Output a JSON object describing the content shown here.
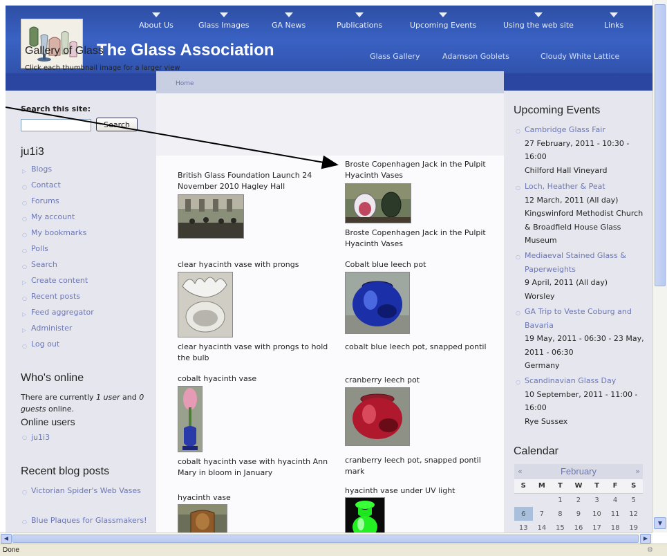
{
  "header": {
    "site_name": "The Glass Association",
    "nav": [
      "About Us",
      "Glass Images",
      "GA News",
      "Publications",
      "Upcoming Events",
      "Using the web site",
      "Links"
    ],
    "subnav": [
      "Glass Gallery",
      "Adamson Goblets",
      "Cloudy White Lattice"
    ]
  },
  "breadcrumb": "Home",
  "page": {
    "title": "Gallery of Glass",
    "intro": "Click each thumbnail image for a larger view"
  },
  "gallery": [
    {
      "title": "British Glass Foundation Launch 24 November 2010 Hagley Hall",
      "caption": ""
    },
    {
      "title": "Broste Copenhagen Jack in the Pulpit Hyacinth Vases",
      "caption": "Broste Copenhagen Jack in the Pulpit Hyacinth Vases"
    },
    {
      "title": "clear hyacinth vase with prongs",
      "caption": "clear hyacinth vase with prongs to hold the bulb"
    },
    {
      "title": "Cobalt blue leech pot",
      "caption": "cobalt blue leech pot, snapped pontil"
    },
    {
      "title": "cobalt hyacinth vase",
      "caption": "cobalt hyacinth vase with hyacinth Ann Mary in bloom in January"
    },
    {
      "title": "cranberry leech pot",
      "caption": "cranberry leech pot, snapped pontil mark"
    },
    {
      "title": "hyacinth vase",
      "caption": ""
    },
    {
      "title": "hyacinth vase under UV light",
      "caption": ""
    }
  ],
  "left_sidebar": {
    "search_label": "Search this site:",
    "search_value": "",
    "search_button": "Search",
    "user_title": "ju1i3",
    "menu": [
      {
        "label": "Blogs",
        "icon": "collapsed-arrow-icon"
      },
      {
        "label": "Contact",
        "icon": "leaf-bullet-icon"
      },
      {
        "label": "Forums",
        "icon": "leaf-bullet-icon"
      },
      {
        "label": "My account",
        "icon": "leaf-bullet-icon"
      },
      {
        "label": "My bookmarks",
        "icon": "leaf-bullet-icon"
      },
      {
        "label": "Polls",
        "icon": "leaf-bullet-icon"
      },
      {
        "label": "Search",
        "icon": "leaf-bullet-icon"
      },
      {
        "label": "Create content",
        "icon": "collapsed-arrow-icon"
      },
      {
        "label": "Recent posts",
        "icon": "leaf-bullet-icon"
      },
      {
        "label": "Feed aggregator",
        "icon": "collapsed-arrow-icon"
      },
      {
        "label": "Administer",
        "icon": "collapsed-arrow-icon"
      },
      {
        "label": "Log out",
        "icon": "leaf-bullet-icon"
      }
    ],
    "whos_online_title": "Who's online",
    "whos_online_text_1": "There are currently ",
    "whos_online_users": "1 user",
    "whos_online_text_2": " and ",
    "whos_online_guests": "0 guests",
    "whos_online_text_3": " online.",
    "online_users_title": "Online users",
    "online_user": "ju1i3",
    "recent_blog_title": "Recent blog posts",
    "recent_blog_posts": [
      "Victorian Spider's Web Vases",
      "Blue Plaques for Glassmakers!"
    ]
  },
  "right_sidebar": {
    "events_title": "Upcoming Events",
    "events": [
      {
        "title": "Cambridge Glass Fair",
        "date": "27 February, 2011 - 10:30 - 16:00",
        "place": "Chilford Hall Vineyard"
      },
      {
        "title": "Loch, Heather & Peat",
        "date": "12 March, 2011 (All day)",
        "place": "Kingswinford Methodist Church & Broadfield House Glass Museum"
      },
      {
        "title": "Mediaeval Stained Glass & Paperweights",
        "date": "9 April, 2011 (All day)",
        "place": "Worsley"
      },
      {
        "title": "GA Trip to Veste Coburg and Bavaria",
        "date": "19 May, 2011 - 06:30 - 23 May, 2011 - 06:30",
        "place": "Germany"
      },
      {
        "title": "Scandinavian Glass Day",
        "date": "10 September, 2011 - 11:00 - 16:00",
        "place": "Rye Sussex"
      }
    ],
    "calendar_title": "Calendar",
    "calendar": {
      "prev": "«",
      "next": "»",
      "month": "February",
      "weekdays": [
        "S",
        "M",
        "T",
        "W",
        "T",
        "F",
        "S"
      ],
      "week1": [
        "",
        "",
        "1",
        "2",
        "3",
        "4",
        "5"
      ],
      "week2": [
        "6",
        "7",
        "8",
        "9",
        "10",
        "11",
        "12"
      ],
      "week3": [
        "13",
        "14",
        "15",
        "16",
        "17",
        "18",
        "19"
      ]
    }
  },
  "browser": {
    "status": "Done"
  },
  "colors": {
    "header_blue": "#3a62c4",
    "link": "#6b76b3",
    "sidebar_bg": "#e6e6ee",
    "today": "#a9c0dc"
  }
}
